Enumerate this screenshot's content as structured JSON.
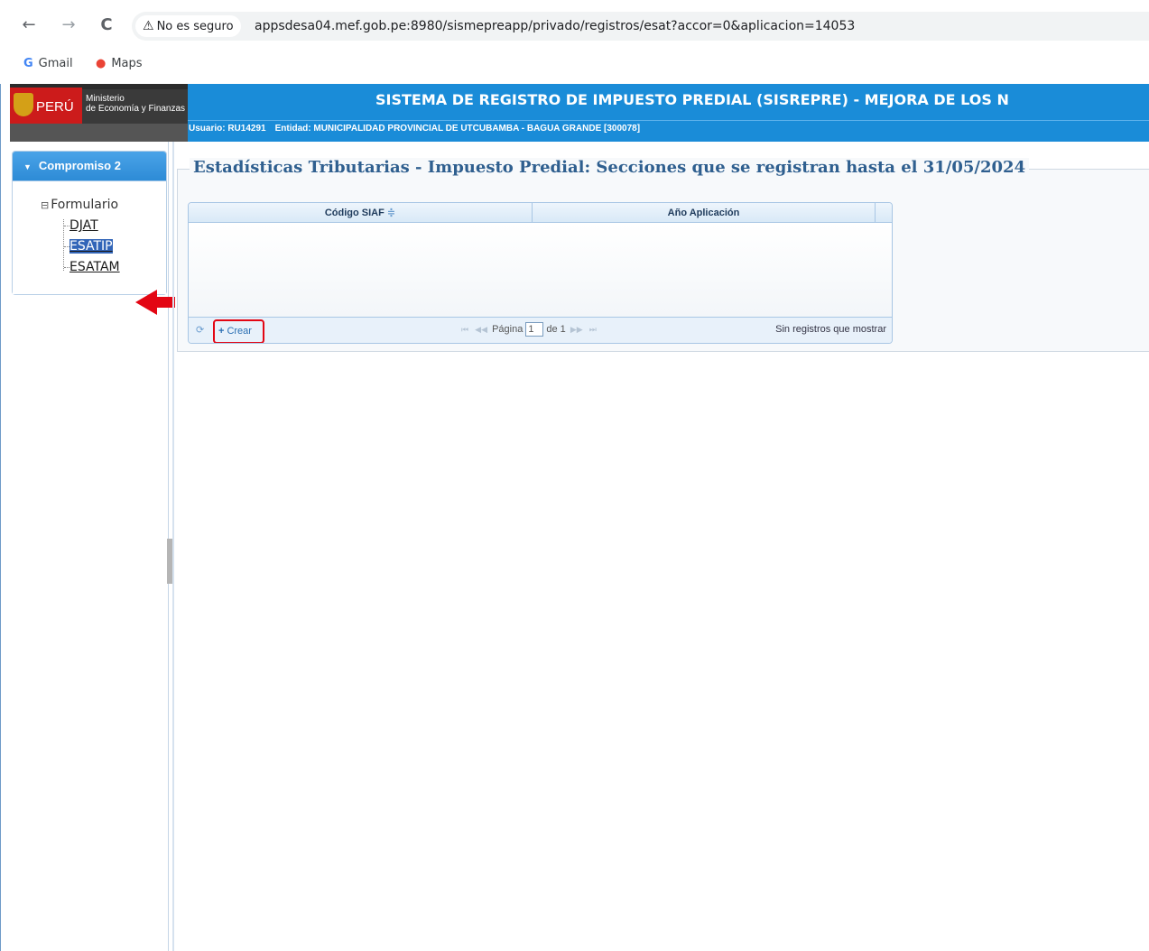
{
  "browser": {
    "back": "←",
    "forward": "→",
    "reload": "C",
    "security_label": "No es seguro",
    "url": "appsdesa04.mef.gob.pe:8980/sismepreapp/privado/registros/esat?accor=0&aplicacion=14053",
    "bookmarks": [
      {
        "icon": "G",
        "label": "Gmail"
      },
      {
        "icon": "●",
        "label": "Maps"
      }
    ]
  },
  "header": {
    "logo_country": "PERÚ",
    "logo_ministry_line1": "Ministerio",
    "logo_ministry_line2": "de Economía y Finanzas",
    "system_title": "SISTEMA DE REGISTRO DE IMPUESTO PREDIAL (SISREPRE) - MEJORA DE LOS N",
    "user_label": "Usuario: RU14291",
    "entity_label": "Entidad: MUNICIPALIDAD PROVINCIAL DE UTCUBAMBA - BAGUA GRANDE [300078]"
  },
  "sidebar": {
    "accordion_title": "Compromiso 2",
    "tree_root": "Formulario",
    "items": [
      {
        "label": "DJAT",
        "selected": false
      },
      {
        "label": "ESATIP",
        "selected": true
      },
      {
        "label": "ESATAM",
        "selected": false
      }
    ]
  },
  "main": {
    "section_title": "Estadísticas Tributarias - Impuesto Predial: Secciones que se registran hasta el 31/05/2024",
    "grid": {
      "columns": [
        "Código SIAF",
        "Año Aplicación"
      ],
      "sort_indicator": "≑",
      "rows": [],
      "create_label": "Crear",
      "page_label": "Página",
      "page_value": "1",
      "of_label": "de 1",
      "empty_message": "Sin registros que mostrar"
    }
  },
  "colors": {
    "header_blue": "#1a8cd8",
    "highlight_red": "#e30613",
    "selected_item": "#3265b8",
    "title_text": "#2f5f8f"
  }
}
